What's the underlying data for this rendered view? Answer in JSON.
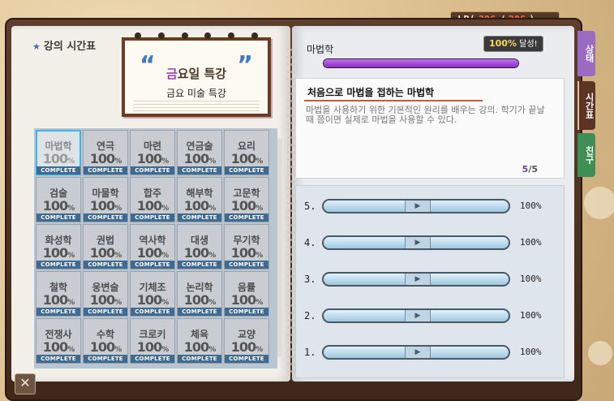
{
  "lp": {
    "prefix": "LP(",
    "current": "306",
    "sep": "/",
    "max": "306",
    "suffix": ")"
  },
  "left": {
    "title": "강의 시간표",
    "notepad": {
      "title_accent": "금",
      "title_rest": "요일 특강",
      "subtitle": "금요 미술 특강"
    },
    "subjects": [
      {
        "name": "마법학",
        "pct": "100",
        "unit": "%",
        "badge": "COMPLETE"
      },
      {
        "name": "연극",
        "pct": "100",
        "unit": "%",
        "badge": "COMPLETE"
      },
      {
        "name": "마련",
        "pct": "100",
        "unit": "%",
        "badge": "COMPLETE"
      },
      {
        "name": "연금술",
        "pct": "100",
        "unit": "%",
        "badge": "COMPLETE"
      },
      {
        "name": "요리",
        "pct": "100",
        "unit": "%",
        "badge": "COMPLETE"
      },
      {
        "name": "검술",
        "pct": "100",
        "unit": "%",
        "badge": "COMPLETE"
      },
      {
        "name": "마물학",
        "pct": "100",
        "unit": "%",
        "badge": "COMPLETE"
      },
      {
        "name": "합주",
        "pct": "100",
        "unit": "%",
        "badge": "COMPLETE"
      },
      {
        "name": "해부학",
        "pct": "100",
        "unit": "%",
        "badge": "COMPLETE"
      },
      {
        "name": "고문학",
        "pct": "100",
        "unit": "%",
        "badge": "COMPLETE"
      },
      {
        "name": "화성학",
        "pct": "100",
        "unit": "%",
        "badge": "COMPLETE"
      },
      {
        "name": "권법",
        "pct": "100",
        "unit": "%",
        "badge": "COMPLETE"
      },
      {
        "name": "역사학",
        "pct": "100",
        "unit": "%",
        "badge": "COMPLETE"
      },
      {
        "name": "대생",
        "pct": "100",
        "unit": "%",
        "badge": "COMPLETE"
      },
      {
        "name": "무기학",
        "pct": "100",
        "unit": "%",
        "badge": "COMPLETE"
      },
      {
        "name": "철학",
        "pct": "100",
        "unit": "%",
        "badge": "COMPLETE"
      },
      {
        "name": "웅변술",
        "pct": "100",
        "unit": "%",
        "badge": "COMPLETE"
      },
      {
        "name": "기체조",
        "pct": "100",
        "unit": "%",
        "badge": "COMPLETE"
      },
      {
        "name": "논리학",
        "pct": "100",
        "unit": "%",
        "badge": "COMPLETE"
      },
      {
        "name": "음률",
        "pct": "100",
        "unit": "%",
        "badge": "COMPLETE"
      },
      {
        "name": "전쟁사",
        "pct": "100",
        "unit": "%",
        "badge": "COMPLETE"
      },
      {
        "name": "수학",
        "pct": "100",
        "unit": "%",
        "badge": "COMPLETE"
      },
      {
        "name": "크로키",
        "pct": "100",
        "unit": "%",
        "badge": "COMPLETE"
      },
      {
        "name": "체육",
        "pct": "100",
        "unit": "%",
        "badge": "COMPLETE"
      },
      {
        "name": "교양",
        "pct": "100",
        "unit": "%",
        "badge": "COMPLETE"
      }
    ],
    "selected_index": 0,
    "close_label": "✕"
  },
  "right": {
    "subject": "마법학",
    "achieve_pct": "100%",
    "achieve_label": "달성!",
    "progress": 1.0,
    "desc_title": "처음으로 마법을 접하는 마법학",
    "desc_text": "마법을 사용하기 위한 기본적인 원리를 배우는 강의. 학기가 끝날 때 쯤이면 실제로 마법을 사용할 수 있다.",
    "page_current": "5",
    "page_sep": "/",
    "page_total": "5",
    "lessons": [
      {
        "no": "5.",
        "pct": "100%"
      },
      {
        "no": "4.",
        "pct": "100%"
      },
      {
        "no": "3.",
        "pct": "100%"
      },
      {
        "no": "2.",
        "pct": "100%"
      },
      {
        "no": "1.",
        "pct": "100%"
      }
    ]
  },
  "tabs": [
    {
      "label": "상태"
    },
    {
      "label": "시간표"
    },
    {
      "label": "친구"
    }
  ],
  "colors": {
    "accent_purple": "#9d3fb8",
    "complete_blue": "#3f6a92",
    "select_cyan": "#35b8e8"
  }
}
